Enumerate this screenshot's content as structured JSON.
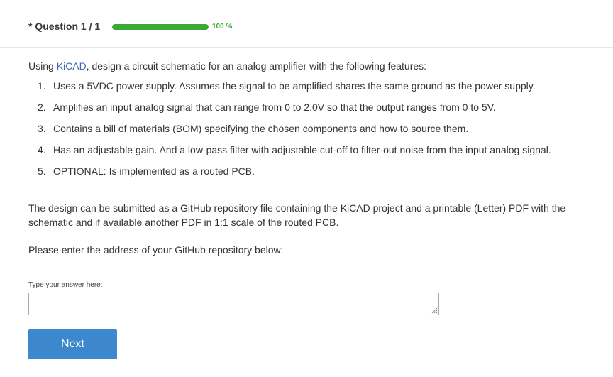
{
  "header": {
    "question_label": "* Question 1 / 1",
    "progress_percent": 100,
    "progress_text": "100 %",
    "progress_color": "#3aa935"
  },
  "question": {
    "intro_prefix": "Using ",
    "intro_link": "KiCAD",
    "intro_suffix": ", design a circuit schematic for an analog amplifier with the following features:",
    "features": [
      {
        "num": "1.",
        "text": "Uses a 5VDC power supply. Assumes the signal to be amplified shares the same ground as the power supply."
      },
      {
        "num": "2.",
        "text": "Amplifies an input analog signal that can range from 0 to 2.0V so that the output ranges from 0 to 5V."
      },
      {
        "num": "3.",
        "text": "Contains a bill of materials (BOM) specifying the chosen components and how to source them."
      },
      {
        "num": "4.",
        "text": "Has an adjustable gain. And a low-pass filter with adjustable cut-off to filter-out noise from the input analog signal."
      },
      {
        "num": "5.",
        "text": "OPTIONAL: Is implemented as a routed PCB."
      }
    ],
    "submission_text": "The design can be submitted as a GitHub repository file containing the KiCAD project and a printable (Letter) PDF with the schematic and if available another PDF in 1:1 scale of the routed PCB.",
    "prompt_text": "Please enter the address of your GitHub repository below:"
  },
  "answer": {
    "label": "Type your answer here:",
    "value": ""
  },
  "actions": {
    "next_label": "Next",
    "next_color": "#3d88cc"
  }
}
